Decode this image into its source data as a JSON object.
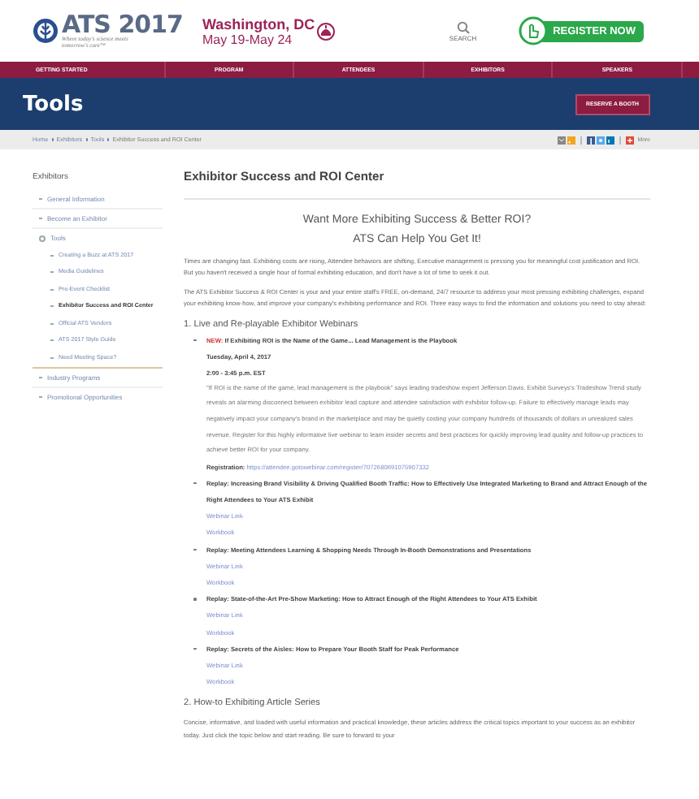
{
  "header": {
    "logo_title": "ATS 2017",
    "tagline": "Where today's science meets tomorrow's care™",
    "city": "Washington, DC",
    "dates": "May 19-May 24",
    "search_label": "SEARCH",
    "register_button": "REGISTER NOW"
  },
  "nav": [
    {
      "label": "GETTING STARTED"
    },
    {
      "label": "PROGRAM"
    },
    {
      "label": "ATTENDEES"
    },
    {
      "label": "EXHIBITORS"
    },
    {
      "label": "SPEAKERS"
    }
  ],
  "banner": {
    "title": "Tools",
    "button": "RESERVE A BOOTH"
  },
  "breadcrumb": {
    "items": [
      "Home",
      "Exhibitors",
      "Tools",
      "Exhibitor Success and ROI Center"
    ],
    "more_label": "More"
  },
  "sidebar": {
    "title": "Exhibitors",
    "items": [
      {
        "label": "General Information",
        "expanded": false,
        "selected": false
      },
      {
        "label": "Become an Exhibitor",
        "expanded": false,
        "selected": false
      },
      {
        "label": "Tools",
        "expanded": true,
        "selected": false,
        "children": [
          {
            "label": "Creating a Buzz at ATS 2017",
            "selected": false
          },
          {
            "label": "Media Guidelines",
            "selected": false
          },
          {
            "label": "Pre-Event Checklist",
            "selected": false
          },
          {
            "label": "Exhibitor Success and ROI Center",
            "selected": true
          },
          {
            "label": "Official ATS Vendors",
            "selected": false
          },
          {
            "label": "ATS 2017 Style Guide",
            "selected": false
          },
          {
            "label": "Need Meeting Space?",
            "selected": false
          }
        ]
      },
      {
        "label": "Industry Programs",
        "expanded": false,
        "selected": false
      },
      {
        "label": "Promotional Opportunities",
        "expanded": false,
        "selected": false
      }
    ]
  },
  "main": {
    "title": "Exhibitor Success and ROI Center",
    "headline": "Want More Exhibiting Success & Better ROI?",
    "subheadline": "ATS Can Help You Get It!",
    "paragraphs": [
      "Times are changing fast. Exhibiting costs are rising, Attendee behaviors are shifting, Executive management is pressing you for meaningful cost justification and ROI. But you haven't received a single hour of formal exhibiting education, and don't have a lot of time to seek it out.",
      "The ATS Exhibitor Success & ROI Center is your and your entire staff's FREE, on-demand, 24/7 resource to address your most pressing exhibiting challenges, expand your exhibiting know-how, and improve your company's exhibiting performance and ROI. Three easy ways to find the information and solutions you need to stay ahead:"
    ],
    "sections": [
      {
        "heading": "1. Live and Re-playable Exhibitor Webinars",
        "webinars": [
          {
            "kind": "live",
            "badge": "NEW:",
            "title": "If Exhibiting ROI is the Name of the Game... Lead Management is the Playbook",
            "date": "Tuesday, April 4, 2017",
            "time": "2:00 - 3:45 p.m. EST",
            "description": "\"If ROI is the name of the game, lead management is the playbook\" says leading tradeshow expert Jefferson Davis. Exhibit Surveys's Tradeshow Trend study reveals an alarming disconnect between exhibitor lead capture and attendee satisfaction with exhibitor follow-up. Failure to effectively manage leads may negatively impact your company's brand in the marketplace and may be quietly costing your company hundreds of thousands of dollars in unrealized sales revenue. Register for this highly informative live webinar to learn insider secrets and best practices for quickly improving lead quality and follow-up practices to achieve better ROI for your company.",
            "registration_label": "Registration:",
            "registration_url": "https://attendee.gotowebinar.com/register/7072680691075907332"
          },
          {
            "kind": "replay",
            "title": "Replay: Increasing Brand Visibility & Driving Qualified Booth Traffic: How to Effectively Use Integrated Marketing to Brand and Attract Enough of the Right Attendees to Your ATS Exhibit",
            "links": [
              "Webinar Link",
              "Workbook"
            ]
          },
          {
            "kind": "replay",
            "title": "Replay: Meeting Attendees Learning & Shopping Needs Through In-Booth Demonstrations and Presentations",
            "links": [
              "Webinar Link",
              "Workbook"
            ]
          },
          {
            "kind": "replay",
            "title": "Replay: State-of-the-Art Pre-Show Marketing: How to Attract Enough of the Right Attendees to Your ATS Exhibit",
            "links": [
              "Webinar Link",
              "Workbook"
            ]
          },
          {
            "kind": "replay",
            "title": "Replay: Secrets of the Aisles: How to Prepare Your Booth Staff for Peak Performance",
            "links": [
              "Webinar Link",
              "Workbook"
            ]
          }
        ]
      },
      {
        "heading": "2. How-to Exhibiting Article Series",
        "text": "Concise, informative, and loaded with useful information and practical knowledge, these articles address the critical topics important to your success as an exhibitor today. Just click the topic below and start reading. Be sure to forward to your"
      }
    ]
  }
}
